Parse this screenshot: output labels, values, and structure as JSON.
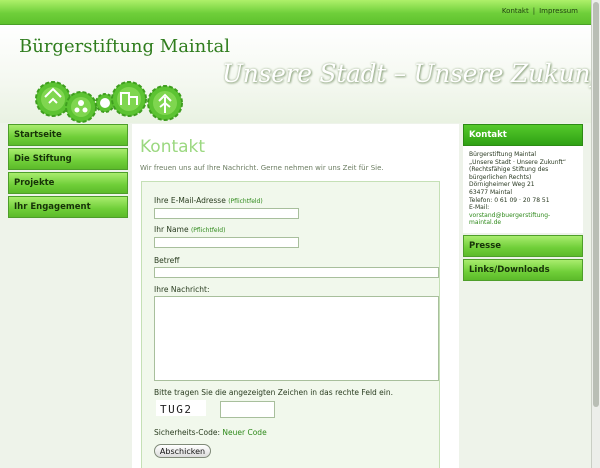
{
  "top_links": [
    "Kontakt",
    "Impressum"
  ],
  "top_separator": "|",
  "header": {
    "site_title": "Bürgerstiftung Maintal",
    "slogan": "Unsere Stadt – Unsere Zukunft"
  },
  "nav": [
    "Startseite",
    "Die Stiftung",
    "Projekte",
    "Ihr Engagement"
  ],
  "main": {
    "title": "Kontakt",
    "intro": "Wir freuen uns auf Ihre Nachricht. Gerne nehmen wir uns Zeit für Sie.",
    "form": {
      "email_label": "Ihre E-Mail-Adresse",
      "required_note": "(Pflichtfeld)",
      "email_value": "",
      "name_label": "Ihr Name",
      "name_value": "",
      "subject_label": "Betreff",
      "subject_value": "",
      "message_label": "Ihre Nachricht:",
      "message_value": "",
      "captcha_instruction": "Bitte tragen Sie die angezeigten Zeichen in das rechte Feld ein.",
      "captcha_text": "TUG2",
      "captcha_value": "",
      "security_code_label": "Sicherheits-Code:",
      "new_code_link": "Neuer Code",
      "submit_label": "Abschicken"
    }
  },
  "sidebar": {
    "contact_heading": "Kontakt",
    "contact_lines": [
      "Bürgerstiftung Maintal",
      "„Unsere Stadt · Unsere Zukunft“",
      "(Rechtsfähige Stiftung des",
      "bürgerlichen Rechts)",
      "Dörnigheimer Weg 21",
      "63477 Maintal",
      "Telefon: 0 61 09 · 20 78 51",
      "E-Mail:"
    ],
    "email_line1": "vorstand@buergerstiftung-",
    "email_line2": "maintal.de",
    "items": [
      "Presse",
      "Links/Downloads"
    ]
  },
  "colors": {
    "accent_green": "#6fce38",
    "dark_green": "#2fa114",
    "title_green": "#2f7d1d",
    "link_green": "#2f8a1b"
  }
}
